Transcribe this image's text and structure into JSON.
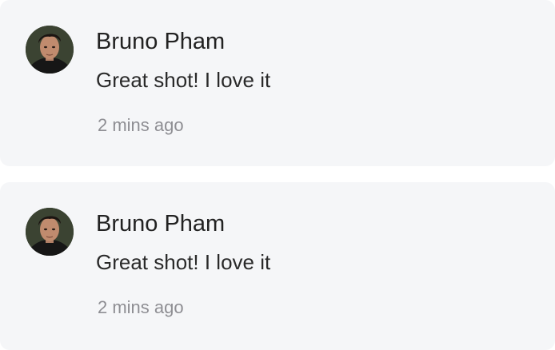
{
  "comments": [
    {
      "author": "Bruno Pham",
      "text": "Great shot! I love it",
      "time": "2 mins ago",
      "avatar_icon": "user-avatar-photo"
    },
    {
      "author": "Bruno Pham",
      "text": "Great shot! I love it",
      "time": "2 mins ago",
      "avatar_icon": "user-avatar-photo"
    }
  ],
  "colors": {
    "card_background": "#f5f6f8",
    "author_text": "#222222",
    "comment_text": "#2a2a2a",
    "timestamp_text": "#8e8e93"
  }
}
